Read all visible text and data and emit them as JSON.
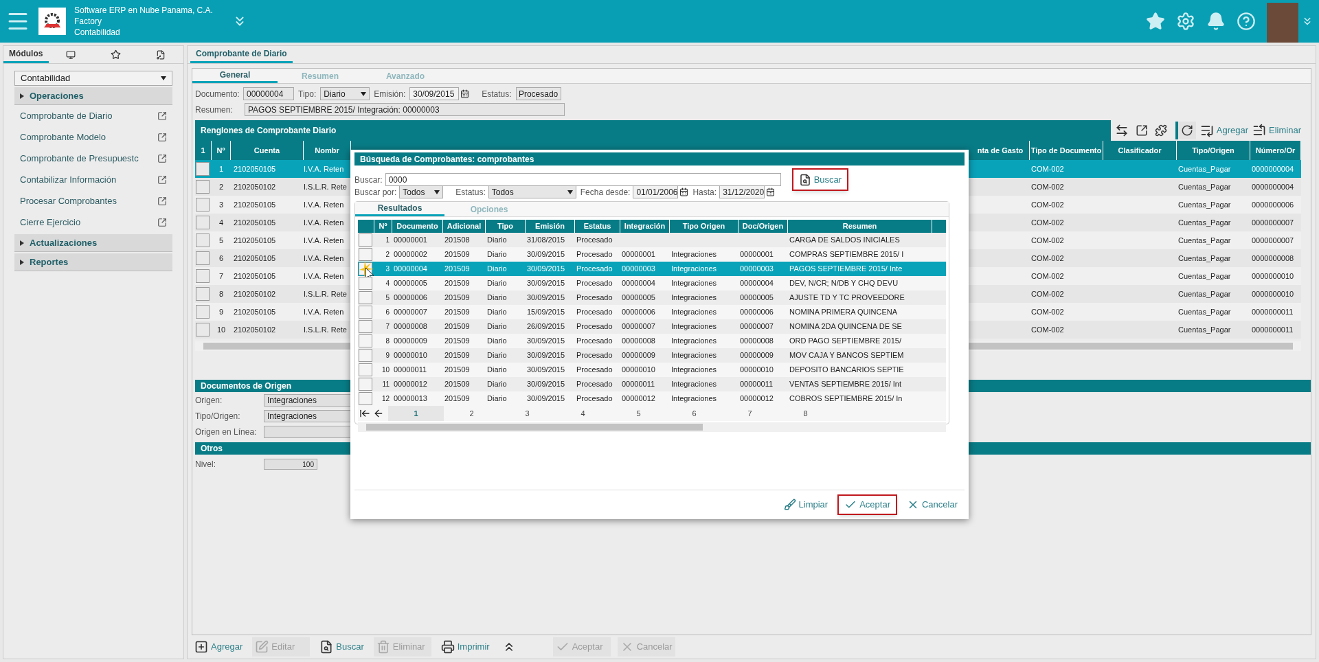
{
  "header": {
    "company": "Software ERP en Nube Panama, C.A.",
    "site": "Factory",
    "module": "Contabilidad"
  },
  "sidebar": {
    "tabs": [
      {
        "kind": "text",
        "label": "Módulos",
        "selected": true
      },
      {
        "kind": "monitor",
        "selected": false
      },
      {
        "kind": "star",
        "selected": false
      },
      {
        "kind": "document",
        "selected": false
      }
    ],
    "module_select": "Contabilidad",
    "groups": [
      {
        "label": "Operaciones",
        "items": [
          "Comprobante de Diario",
          "Comprobante Modelo",
          "Comprobante de Presupuestc",
          "Contabilizar Información",
          "Procesar Comprobantes",
          "Cierre Ejercicio"
        ]
      },
      {
        "label": "Actualizaciones"
      },
      {
        "label": "Reportes"
      }
    ]
  },
  "main_tabs": [
    {
      "label": "Comprobante de Diario",
      "selected": true
    }
  ],
  "form_tabs": [
    {
      "label": "General",
      "selected": true
    },
    {
      "label": "Resumen",
      "selected": false
    },
    {
      "label": "Avanzado",
      "selected": false
    }
  ],
  "fields": [
    {
      "kind": "text",
      "label": "Documento:",
      "value": "00000004"
    },
    {
      "kind": "select",
      "label": "Tipo:",
      "value": "Diario"
    },
    {
      "kind": "date",
      "label": "Emisión:",
      "value": "30/09/2015"
    },
    {
      "kind": "text",
      "label": "Estatus:",
      "value": "Procesado"
    }
  ],
  "resumen": {
    "label": "Resumen:",
    "value": "PAGOS SEPTIEMBRE 2015/ Integración: 00000003"
  },
  "lines": {
    "title": "Renglones de Comprobante Diario",
    "toolbar": [
      {
        "kind": "expand"
      },
      {
        "kind": "open"
      },
      {
        "kind": "puzzle"
      },
      {
        "kind": "refresh"
      },
      {
        "kind": "add",
        "label": "Agregar"
      },
      {
        "kind": "remove",
        "label": "Eliminar"
      }
    ],
    "left_columns": [
      "1",
      "Nº",
      "Cuenta",
      "Nombr"
    ],
    "right_columns": [
      "nta de Gasto",
      "Tipo de Documento",
      "Clasificador",
      "Tipo/Origen",
      "Número/Or"
    ],
    "rows": [
      {
        "selected": true,
        "n": "1",
        "cuenta": "2102050105",
        "nombre": "I.V.A. Reten",
        "tipo_documento": "COM-002",
        "tipo_origen": "Cuentas_Pagar",
        "numero": "0000000004"
      },
      {
        "selected": false,
        "n": "2",
        "cuenta": "2102050102",
        "nombre": "I.S.L.R. Rete",
        "tipo_documento": "COM-002",
        "tipo_origen": "Cuentas_Pagar",
        "numero": "0000000004"
      },
      {
        "selected": false,
        "n": "3",
        "cuenta": "2102050105",
        "nombre": "I.V.A. Reten",
        "tipo_documento": "COM-002",
        "tipo_origen": "Cuentas_Pagar",
        "numero": "0000000006"
      },
      {
        "selected": false,
        "n": "4",
        "cuenta": "2102050105",
        "nombre": "I.V.A. Reten",
        "tipo_documento": "COM-002",
        "tipo_origen": "Cuentas_Pagar",
        "numero": "0000000007"
      },
      {
        "selected": false,
        "n": "5",
        "cuenta": "2102050105",
        "nombre": "I.V.A. Reten",
        "tipo_documento": "COM-002",
        "tipo_origen": "Cuentas_Pagar",
        "numero": "0000000007"
      },
      {
        "selected": false,
        "n": "6",
        "cuenta": "2102050105",
        "nombre": "I.V.A. Reten",
        "tipo_documento": "COM-002",
        "tipo_origen": "Cuentas_Pagar",
        "numero": "0000000008"
      },
      {
        "selected": false,
        "n": "7",
        "cuenta": "2102050105",
        "nombre": "I.V.A. Reten",
        "tipo_documento": "COM-002",
        "tipo_origen": "Cuentas_Pagar",
        "numero": "0000000010"
      },
      {
        "selected": false,
        "n": "8",
        "cuenta": "2102050102",
        "nombre": "I.S.L.R. Rete",
        "tipo_documento": "COM-002",
        "tipo_origen": "Cuentas_Pagar",
        "numero": "0000000010"
      },
      {
        "selected": false,
        "n": "9",
        "cuenta": "2102050105",
        "nombre": "I.V.A. Reten",
        "tipo_documento": "COM-002",
        "tipo_origen": "Cuentas_Pagar",
        "numero": "0000000011"
      },
      {
        "selected": false,
        "n": "10",
        "cuenta": "2102050102",
        "nombre": "I.S.L.R. Rete",
        "tipo_documento": "COM-002",
        "tipo_origen": "Cuentas_Pagar",
        "numero": "0000000011"
      }
    ]
  },
  "origin": {
    "title": "Documentos de Origen",
    "fields": [
      {
        "label": "Origen:",
        "value": "Integraciones"
      },
      {
        "label": "Tipo/Origen:",
        "value": "Integraciones"
      },
      {
        "label": "Origen en Línea:"
      }
    ]
  },
  "others": {
    "title": "Otros",
    "fields": [
      {
        "label": "Nivel:",
        "value": "100"
      }
    ]
  },
  "bottom_toolbar": [
    {
      "kind": "add",
      "label": "Agregar",
      "disabled": false
    },
    {
      "kind": "edit",
      "label": "Editar",
      "disabled": true
    },
    {
      "kind": "search",
      "label": "Buscar",
      "disabled": false
    },
    {
      "kind": "delete",
      "label": "Eliminar",
      "disabled": true
    },
    {
      "kind": "print",
      "label": "Imprimir",
      "disabled": false
    },
    {
      "kind": "collapse",
      "disabled": false
    },
    {
      "kind": "accept",
      "label": "Aceptar",
      "disabled": true
    },
    {
      "kind": "cancel",
      "label": "Cancelar",
      "disabled": true
    }
  ],
  "dialog": {
    "title": "Búsqueda de Comprobantes: comprobantes",
    "search": {
      "label": "Buscar:",
      "value": "0000"
    },
    "search_button": {
      "label": "Buscar",
      "highlighted": true
    },
    "filters": [
      {
        "kind": "select",
        "label": "Buscar por:",
        "value": "Todos"
      },
      {
        "kind": "select",
        "label": "Estatus:",
        "value": "Todos"
      },
      {
        "kind": "date",
        "label": "Fecha desde:",
        "value": "01/01/2006"
      },
      {
        "kind": "date",
        "label": "Hasta:",
        "value": "31/12/2020"
      }
    ],
    "tabs": [
      {
        "label": "Resultados",
        "selected": true
      },
      {
        "label": "Opciones",
        "selected": false
      }
    ],
    "columns": [
      "Nº",
      "Documento",
      "Adicional",
      "Tipo",
      "Emisión",
      "Estatus",
      "Integración",
      "Tipo Origen",
      "Doc/Origen",
      "Resumen"
    ],
    "rows": [
      {
        "selected": false,
        "cells": [
          "1",
          "00000001",
          "201508",
          "Diario",
          "31/08/2015",
          "Procesado",
          "",
          "",
          "",
          "CARGA DE SALDOS INICIALES"
        ]
      },
      {
        "selected": false,
        "cells": [
          "2",
          "00000002",
          "201509",
          "Diario",
          "30/09/2015",
          "Procesado",
          "00000001",
          "Integraciones",
          "00000001",
          "COMPRAS SEPTIEMBRE 2015/ I"
        ]
      },
      {
        "selected": true,
        "cells": [
          "3",
          "00000004",
          "201509",
          "Diario",
          "30/09/2015",
          "Procesado",
          "00000003",
          "Integraciones",
          "00000003",
          "PAGOS SEPTIEMBRE 2015/ Inte"
        ]
      },
      {
        "selected": false,
        "cells": [
          "4",
          "00000005",
          "201509",
          "Diario",
          "30/09/2015",
          "Procesado",
          "00000004",
          "Integraciones",
          "00000004",
          "DEV, N/CR; N/DB Y CHQ DEVU"
        ]
      },
      {
        "selected": false,
        "cells": [
          "5",
          "00000006",
          "201509",
          "Diario",
          "30/09/2015",
          "Procesado",
          "00000005",
          "Integraciones",
          "00000005",
          "AJUSTE TD Y TC PROVEEDORE"
        ]
      },
      {
        "selected": false,
        "cells": [
          "6",
          "00000007",
          "201509",
          "Diario",
          "15/09/2015",
          "Procesado",
          "00000006",
          "Integraciones",
          "00000006",
          "NOMINA PRIMERA QUINCENA"
        ]
      },
      {
        "selected": false,
        "cells": [
          "7",
          "00000008",
          "201509",
          "Diario",
          "26/09/2015",
          "Procesado",
          "00000007",
          "Integraciones",
          "00000007",
          "NOMINA 2DA QUINCENA DE SE"
        ]
      },
      {
        "selected": false,
        "cells": [
          "8",
          "00000009",
          "201509",
          "Diario",
          "30/09/2015",
          "Procesado",
          "00000008",
          "Integraciones",
          "00000008",
          "ORD PAGO SEPTIEMBRE 2015/"
        ]
      },
      {
        "selected": false,
        "cells": [
          "9",
          "00000010",
          "201509",
          "Diario",
          "30/09/2015",
          "Procesado",
          "00000009",
          "Integraciones",
          "00000009",
          "MOV CAJA Y BANCOS SEPTIEM"
        ]
      },
      {
        "selected": false,
        "cells": [
          "10",
          "00000011",
          "201509",
          "Diario",
          "30/09/2015",
          "Procesado",
          "00000010",
          "Integraciones",
          "00000010",
          "DEPOSITO BANCARIOS SEPTIE"
        ]
      },
      {
        "selected": false,
        "cells": [
          "11",
          "00000012",
          "201509",
          "Diario",
          "30/09/2015",
          "Procesado",
          "00000011",
          "Integraciones",
          "00000011",
          "VENTAS SEPTIEMBRE 2015/ Int"
        ]
      },
      {
        "selected": false,
        "cells": [
          "12",
          "00000013",
          "201509",
          "Diario",
          "30/09/2015",
          "Procesado",
          "00000012",
          "Integraciones",
          "00000012",
          "COBROS SEPTIEMBRE 2015/ In"
        ]
      }
    ],
    "pages": [
      {
        "label": "1",
        "selected": true
      },
      {
        "label": "2",
        "selected": false
      },
      {
        "label": "3",
        "selected": false
      },
      {
        "label": "4",
        "selected": false
      },
      {
        "label": "5",
        "selected": false
      },
      {
        "label": "6",
        "selected": false
      },
      {
        "label": "7",
        "selected": false
      },
      {
        "label": "8",
        "selected": false
      }
    ],
    "buttons": [
      {
        "kind": "clear",
        "label": "Limpiar",
        "highlighted": false
      },
      {
        "kind": "accept",
        "label": "Aceptar",
        "highlighted": true
      },
      {
        "kind": "cancel",
        "label": "Cancelar",
        "highlighted": false
      }
    ]
  }
}
